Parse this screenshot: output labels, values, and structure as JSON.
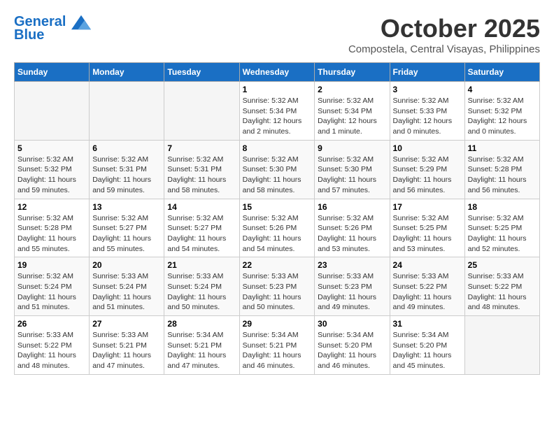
{
  "header": {
    "logo_line1": "General",
    "logo_line2": "Blue",
    "month": "October 2025",
    "location": "Compostela, Central Visayas, Philippines"
  },
  "days_of_week": [
    "Sunday",
    "Monday",
    "Tuesday",
    "Wednesday",
    "Thursday",
    "Friday",
    "Saturday"
  ],
  "weeks": [
    [
      {
        "day": "",
        "sunrise": "",
        "sunset": "",
        "daylight": ""
      },
      {
        "day": "",
        "sunrise": "",
        "sunset": "",
        "daylight": ""
      },
      {
        "day": "",
        "sunrise": "",
        "sunset": "",
        "daylight": ""
      },
      {
        "day": "1",
        "sunrise": "Sunrise: 5:32 AM",
        "sunset": "Sunset: 5:34 PM",
        "daylight": "Daylight: 12 hours and 2 minutes."
      },
      {
        "day": "2",
        "sunrise": "Sunrise: 5:32 AM",
        "sunset": "Sunset: 5:34 PM",
        "daylight": "Daylight: 12 hours and 1 minute."
      },
      {
        "day": "3",
        "sunrise": "Sunrise: 5:32 AM",
        "sunset": "Sunset: 5:33 PM",
        "daylight": "Daylight: 12 hours and 0 minutes."
      },
      {
        "day": "4",
        "sunrise": "Sunrise: 5:32 AM",
        "sunset": "Sunset: 5:32 PM",
        "daylight": "Daylight: 12 hours and 0 minutes."
      }
    ],
    [
      {
        "day": "5",
        "sunrise": "Sunrise: 5:32 AM",
        "sunset": "Sunset: 5:32 PM",
        "daylight": "Daylight: 11 hours and 59 minutes."
      },
      {
        "day": "6",
        "sunrise": "Sunrise: 5:32 AM",
        "sunset": "Sunset: 5:31 PM",
        "daylight": "Daylight: 11 hours and 59 minutes."
      },
      {
        "day": "7",
        "sunrise": "Sunrise: 5:32 AM",
        "sunset": "Sunset: 5:31 PM",
        "daylight": "Daylight: 11 hours and 58 minutes."
      },
      {
        "day": "8",
        "sunrise": "Sunrise: 5:32 AM",
        "sunset": "Sunset: 5:30 PM",
        "daylight": "Daylight: 11 hours and 58 minutes."
      },
      {
        "day": "9",
        "sunrise": "Sunrise: 5:32 AM",
        "sunset": "Sunset: 5:30 PM",
        "daylight": "Daylight: 11 hours and 57 minutes."
      },
      {
        "day": "10",
        "sunrise": "Sunrise: 5:32 AM",
        "sunset": "Sunset: 5:29 PM",
        "daylight": "Daylight: 11 hours and 56 minutes."
      },
      {
        "day": "11",
        "sunrise": "Sunrise: 5:32 AM",
        "sunset": "Sunset: 5:28 PM",
        "daylight": "Daylight: 11 hours and 56 minutes."
      }
    ],
    [
      {
        "day": "12",
        "sunrise": "Sunrise: 5:32 AM",
        "sunset": "Sunset: 5:28 PM",
        "daylight": "Daylight: 11 hours and 55 minutes."
      },
      {
        "day": "13",
        "sunrise": "Sunrise: 5:32 AM",
        "sunset": "Sunset: 5:27 PM",
        "daylight": "Daylight: 11 hours and 55 minutes."
      },
      {
        "day": "14",
        "sunrise": "Sunrise: 5:32 AM",
        "sunset": "Sunset: 5:27 PM",
        "daylight": "Daylight: 11 hours and 54 minutes."
      },
      {
        "day": "15",
        "sunrise": "Sunrise: 5:32 AM",
        "sunset": "Sunset: 5:26 PM",
        "daylight": "Daylight: 11 hours and 54 minutes."
      },
      {
        "day": "16",
        "sunrise": "Sunrise: 5:32 AM",
        "sunset": "Sunset: 5:26 PM",
        "daylight": "Daylight: 11 hours and 53 minutes."
      },
      {
        "day": "17",
        "sunrise": "Sunrise: 5:32 AM",
        "sunset": "Sunset: 5:25 PM",
        "daylight": "Daylight: 11 hours and 53 minutes."
      },
      {
        "day": "18",
        "sunrise": "Sunrise: 5:32 AM",
        "sunset": "Sunset: 5:25 PM",
        "daylight": "Daylight: 11 hours and 52 minutes."
      }
    ],
    [
      {
        "day": "19",
        "sunrise": "Sunrise: 5:32 AM",
        "sunset": "Sunset: 5:24 PM",
        "daylight": "Daylight: 11 hours and 51 minutes."
      },
      {
        "day": "20",
        "sunrise": "Sunrise: 5:33 AM",
        "sunset": "Sunset: 5:24 PM",
        "daylight": "Daylight: 11 hours and 51 minutes."
      },
      {
        "day": "21",
        "sunrise": "Sunrise: 5:33 AM",
        "sunset": "Sunset: 5:24 PM",
        "daylight": "Daylight: 11 hours and 50 minutes."
      },
      {
        "day": "22",
        "sunrise": "Sunrise: 5:33 AM",
        "sunset": "Sunset: 5:23 PM",
        "daylight": "Daylight: 11 hours and 50 minutes."
      },
      {
        "day": "23",
        "sunrise": "Sunrise: 5:33 AM",
        "sunset": "Sunset: 5:23 PM",
        "daylight": "Daylight: 11 hours and 49 minutes."
      },
      {
        "day": "24",
        "sunrise": "Sunrise: 5:33 AM",
        "sunset": "Sunset: 5:22 PM",
        "daylight": "Daylight: 11 hours and 49 minutes."
      },
      {
        "day": "25",
        "sunrise": "Sunrise: 5:33 AM",
        "sunset": "Sunset: 5:22 PM",
        "daylight": "Daylight: 11 hours and 48 minutes."
      }
    ],
    [
      {
        "day": "26",
        "sunrise": "Sunrise: 5:33 AM",
        "sunset": "Sunset: 5:22 PM",
        "daylight": "Daylight: 11 hours and 48 minutes."
      },
      {
        "day": "27",
        "sunrise": "Sunrise: 5:33 AM",
        "sunset": "Sunset: 5:21 PM",
        "daylight": "Daylight: 11 hours and 47 minutes."
      },
      {
        "day": "28",
        "sunrise": "Sunrise: 5:34 AM",
        "sunset": "Sunset: 5:21 PM",
        "daylight": "Daylight: 11 hours and 47 minutes."
      },
      {
        "day": "29",
        "sunrise": "Sunrise: 5:34 AM",
        "sunset": "Sunset: 5:21 PM",
        "daylight": "Daylight: 11 hours and 46 minutes."
      },
      {
        "day": "30",
        "sunrise": "Sunrise: 5:34 AM",
        "sunset": "Sunset: 5:20 PM",
        "daylight": "Daylight: 11 hours and 46 minutes."
      },
      {
        "day": "31",
        "sunrise": "Sunrise: 5:34 AM",
        "sunset": "Sunset: 5:20 PM",
        "daylight": "Daylight: 11 hours and 45 minutes."
      },
      {
        "day": "",
        "sunrise": "",
        "sunset": "",
        "daylight": ""
      }
    ]
  ]
}
